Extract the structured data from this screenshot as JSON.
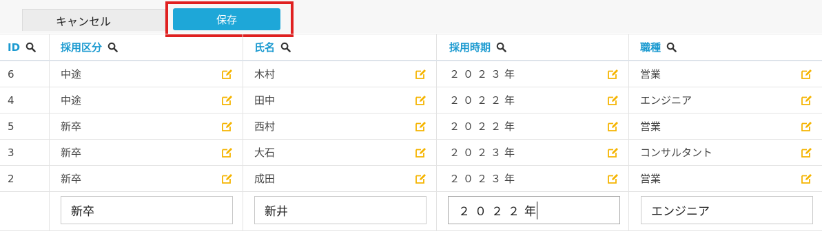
{
  "toolbar": {
    "cancel_label": "キャンセル",
    "save_label": "保存"
  },
  "table": {
    "headers": [
      "ID",
      "採用区分",
      "氏名",
      "採用時期",
      "職種"
    ],
    "rows": [
      [
        "6",
        "中途",
        "木村",
        "２０２３年",
        "営業"
      ],
      [
        "4",
        "中途",
        "田中",
        "２０２２年",
        "エンジニア"
      ],
      [
        "5",
        "新卒",
        "西村",
        "２０２２年",
        "営業"
      ],
      [
        "3",
        "新卒",
        "大石",
        "２０２３年",
        "コンサルタント"
      ],
      [
        "2",
        "新卒",
        "成田",
        "２０２３年",
        "営業"
      ]
    ],
    "new_row": [
      "新卒",
      "新井",
      "２０２２年",
      "エンジニア"
    ]
  },
  "colors": {
    "accent": "#1ea7d8",
    "header_text": "#1b9ad0",
    "edit_icon": "#f5b400",
    "highlight": "#e02020"
  },
  "icons": {
    "header_action": "search-icon",
    "row_action": "edit-icon"
  }
}
